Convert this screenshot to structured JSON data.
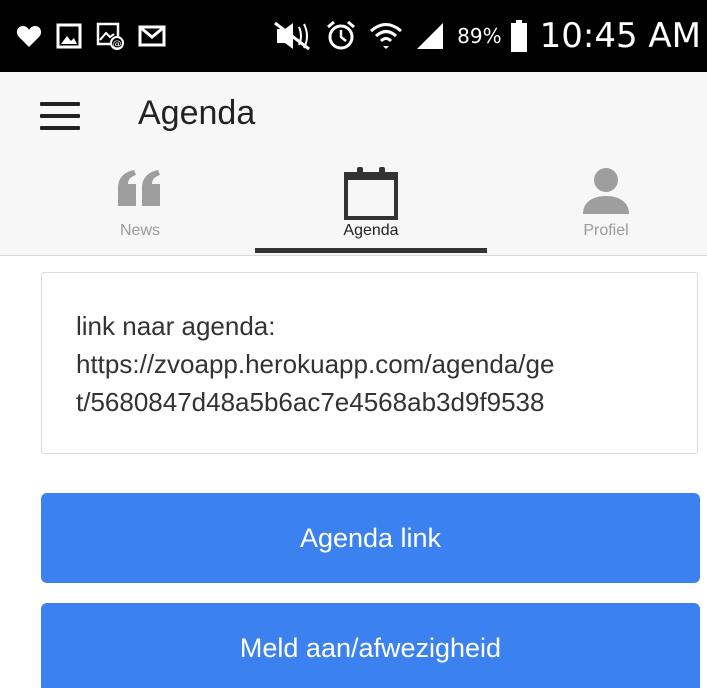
{
  "status_bar": {
    "battery_percent": "89%",
    "time": "10:45 AM",
    "icons": [
      "heart-icon",
      "gallery-icon",
      "screenshot-icon",
      "gmail-icon",
      "mute-icon",
      "alarm-icon",
      "wifi-icon",
      "signal-icon",
      "battery-icon"
    ]
  },
  "app_bar": {
    "title": "Agenda",
    "menu_icon": "hamburger-menu-icon"
  },
  "tabs": [
    {
      "label": "News",
      "icon": "quote-icon",
      "active": false
    },
    {
      "label": "Agenda",
      "icon": "calendar-icon",
      "active": true
    },
    {
      "label": "Profiel",
      "icon": "person-icon",
      "active": false
    }
  ],
  "card": {
    "lines": [
      "link naar agenda:",
      "https://zvoapp.herokuapp.com/agenda/ge",
      "t/5680847d48a5b6ac7e4568ab3d9f9538"
    ]
  },
  "buttons": {
    "agenda_link": "Agenda link",
    "meld_aan": "Meld aan/afwezigheid"
  },
  "colors": {
    "accent": "#3b82f0",
    "status_bar": "#000000",
    "app_bar": "#f7f7f7"
  }
}
